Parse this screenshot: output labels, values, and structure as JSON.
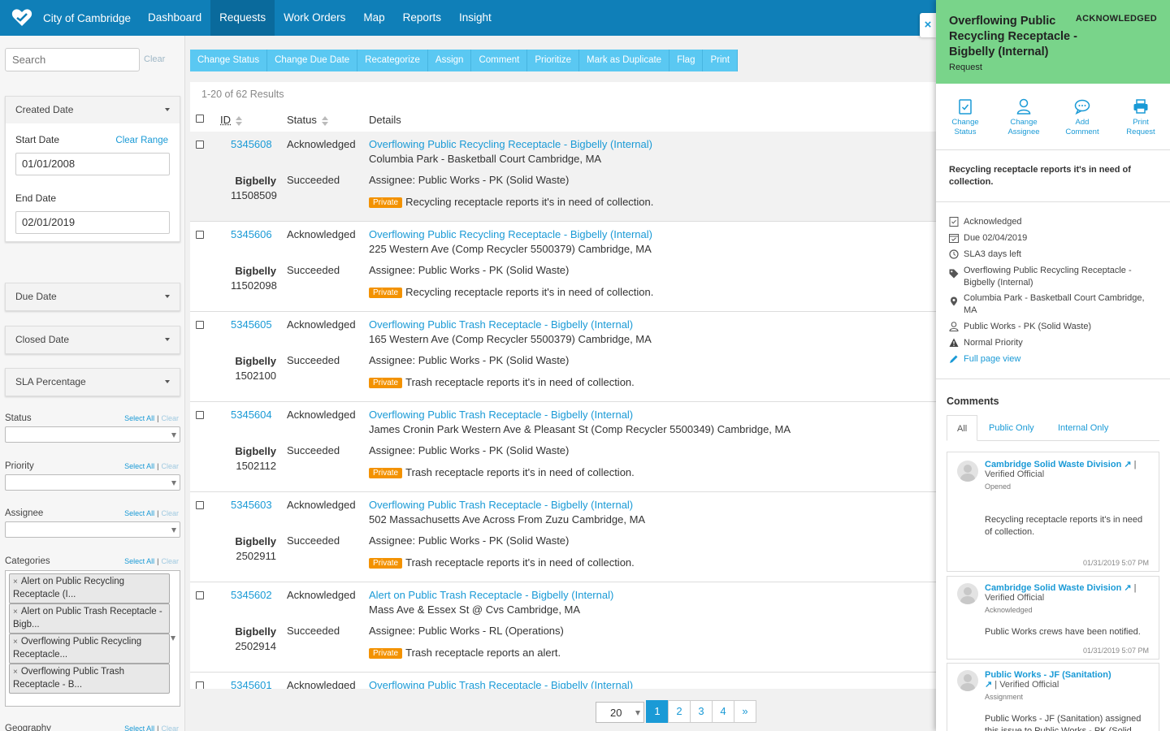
{
  "nav": {
    "brand": "City of Cambridge",
    "items": [
      {
        "label": "Dashboard",
        "active": false
      },
      {
        "label": "Requests",
        "active": true
      },
      {
        "label": "Work Orders",
        "active": false
      },
      {
        "label": "Map",
        "active": false
      },
      {
        "label": "Reports",
        "active": false
      },
      {
        "label": "Insight",
        "active": false
      }
    ]
  },
  "sidebar": {
    "search_placeholder": "Search",
    "search_clear": "Clear",
    "created_date": {
      "label": "Created Date",
      "start_label": "Start Date",
      "clear_range": "Clear Range",
      "start_value": "01/01/2008",
      "end_label": "End Date",
      "end_value": "02/01/2019"
    },
    "collapsed_filters": [
      "Due Date",
      "Closed Date",
      "SLA Percentage"
    ],
    "select_all": "Select All",
    "clear": "Clear",
    "status_label": "Status",
    "priority_label": "Priority",
    "assignee_label": "Assignee",
    "categories_label": "Categories",
    "geography_label": "Geography",
    "category_chips": [
      "Alert on Public Recycling Receptacle (I...",
      "Alert on Public Trash Receptacle - Bigb...",
      "Overflowing Public Recycling Receptacle...",
      "Overflowing Public Trash Receptacle - B..."
    ]
  },
  "toolbar": [
    "Change Status",
    "Change Due Date",
    "Recategorize",
    "Assign",
    "Comment",
    "Prioritize",
    "Mark as Duplicate",
    "Flag",
    "Print"
  ],
  "list": {
    "results": "1-20 of 62 Results",
    "col_id": "ID",
    "col_status": "Status",
    "col_details": "Details",
    "private_label": "Private",
    "rows": [
      {
        "id": "5345608",
        "status": "Acknowledged",
        "title": "Overflowing Public Recycling Receptacle - Bigbelly (Internal)",
        "address": "Columbia Park - Basketball Court Cambridge, MA",
        "type": "Bigbelly",
        "type_id": "11508509",
        "sub_status": "Succeeded",
        "assignee": "Assignee: Public Works - PK (Solid Waste)",
        "desc": "Recycling receptacle reports it's in need of collection."
      },
      {
        "id": "5345606",
        "status": "Acknowledged",
        "title": "Overflowing Public Recycling Receptacle - Bigbelly (Internal)",
        "address": "225 Western Ave (Comp Recycler 5500379) Cambridge, MA",
        "type": "Bigbelly",
        "type_id": "11502098",
        "sub_status": "Succeeded",
        "assignee": "Assignee: Public Works - PK (Solid Waste)",
        "desc": "Recycling receptacle reports it's in need of collection."
      },
      {
        "id": "5345605",
        "status": "Acknowledged",
        "title": "Overflowing Public Trash Receptacle - Bigbelly (Internal)",
        "address": "165 Western Ave (Comp Recycler 5500379) Cambridge, MA",
        "type": "Bigbelly",
        "type_id": "1502100",
        "sub_status": "Succeeded",
        "assignee": "Assignee: Public Works - PK (Solid Waste)",
        "desc": "Trash receptacle reports it's in need of collection."
      },
      {
        "id": "5345604",
        "status": "Acknowledged",
        "title": "Overflowing Public Trash Receptacle - Bigbelly (Internal)",
        "address": "James Cronin Park Western Ave & Pleasant St (Comp Recycler 5500349) Cambridge, MA",
        "type": "Bigbelly",
        "type_id": "1502112",
        "sub_status": "Succeeded",
        "assignee": "Assignee: Public Works - PK (Solid Waste)",
        "desc": "Trash receptacle reports it's in need of collection."
      },
      {
        "id": "5345603",
        "status": "Acknowledged",
        "title": "Overflowing Public Trash Receptacle - Bigbelly (Internal)",
        "address": "502 Massachusetts Ave Across From Zuzu Cambridge, MA",
        "type": "Bigbelly",
        "type_id": "2502911",
        "sub_status": "Succeeded",
        "assignee": "Assignee: Public Works - PK (Solid Waste)",
        "desc": "Trash receptacle reports it's in need of collection."
      },
      {
        "id": "5345602",
        "status": "Acknowledged",
        "title": "Alert on Public Trash Receptacle - Bigbelly (Internal)",
        "address": "Mass Ave & Essex St @ Cvs Cambridge, MA",
        "type": "Bigbelly",
        "type_id": "2502914",
        "sub_status": "Succeeded",
        "assignee": "Assignee: Public Works - RL (Operations)",
        "desc": "Trash receptacle reports an alert."
      },
      {
        "id": "5345601",
        "status": "Acknowledged",
        "title": "Overflowing Public Trash Receptacle - Bigbelly (Internal)",
        "address": "",
        "type": "",
        "type_id": "",
        "sub_status": "",
        "assignee": "",
        "desc": ""
      }
    ]
  },
  "pagination": {
    "per_page": "20",
    "pages": [
      "1",
      "2",
      "3",
      "4"
    ],
    "next": "»"
  },
  "detail": {
    "close": "×",
    "title": "Overflowing Public Recycling Receptacle - Bigbelly (Internal)",
    "kind": "Request",
    "status": "ACKNOWLEDGED",
    "actions": [
      {
        "line1": "Change",
        "line2": "Status"
      },
      {
        "line1": "Change",
        "line2": "Assignee"
      },
      {
        "line1": "Add",
        "line2": "Comment"
      },
      {
        "line1": "Print",
        "line2": "Request"
      }
    ],
    "summary": "Recycling receptacle reports it's in need of collection.",
    "info": {
      "status": "Acknowledged",
      "due": "Due  02/04/2019",
      "sla": "SLA3 days left",
      "category": "Overflowing Public Recycling Receptacle - Bigbelly (Internal)",
      "location": "Columbia Park - Basketball Court Cambridge, MA",
      "assignee": "Public Works - PK (Solid Waste)",
      "priority": "Normal Priority",
      "full_view": "Full page view"
    },
    "comments_title": "Comments",
    "tabs": [
      "All",
      "Public Only",
      "Internal Only"
    ],
    "comments": [
      {
        "author": "Cambridge Solid Waste Division",
        "verified": "| Verified Official",
        "type": "Opened",
        "text": "Recycling receptacle reports it's in need of collection.",
        "time": "01/31/2019 5:07 PM"
      },
      {
        "author": "Cambridge Solid Waste Division",
        "verified": "| Verified Official",
        "type": "Acknowledged",
        "text": "Public Works crews have been notified.",
        "time": "01/31/2019 5:07 PM"
      },
      {
        "author": "Public Works - JF (Sanitation)",
        "verified": "| Verified Official",
        "type": "Assignment",
        "text": "Public Works - JF (Sanitation) assigned this issue to Public Works - PK (Solid Waste)",
        "time": ""
      }
    ]
  },
  "colors": {
    "nav": "#0f7fb8",
    "accent": "#1a9ad6",
    "toolbar": "#5ac8f2",
    "detail_header": "#79d48a",
    "private_badge": "#f39200"
  }
}
